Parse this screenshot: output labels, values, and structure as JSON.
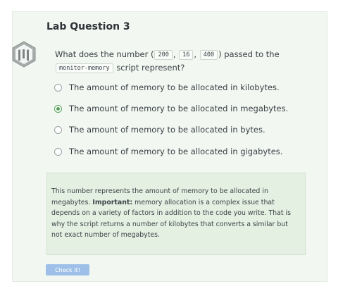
{
  "title": "Lab Question 3",
  "question": {
    "prefix": "What does the number (",
    "codes": [
      "200",
      "16",
      "400"
    ],
    "sep": ",",
    "mid": ") passed to the",
    "script_code": "monitor-memory",
    "suffix": "script represent?"
  },
  "options": [
    {
      "label": "The amount of memory to be allocated in kilobytes.",
      "checked": false
    },
    {
      "label": "The amount of memory to be allocated in megabytes.",
      "checked": true
    },
    {
      "label": "The amount of memory to be allocated in bytes.",
      "checked": false
    },
    {
      "label": "The amount of memory to be allocated in gigabytes.",
      "checked": false
    }
  ],
  "feedback": {
    "text1": "This number represents the amount of memory to be allocated in megabytes. ",
    "bold": "Important:",
    "text2": " memory allocation is a complex issue that depends on a variety of factors in addition to the code you write. That is why the script returns a number of kilobytes that converts a similar but not exact number of megabytes."
  },
  "button_label": "Check It!",
  "colors": {
    "accent": "#58a05a",
    "button": "#9ec0e8",
    "card": "#f2f7f2",
    "feedback": "#e4f0e2"
  }
}
